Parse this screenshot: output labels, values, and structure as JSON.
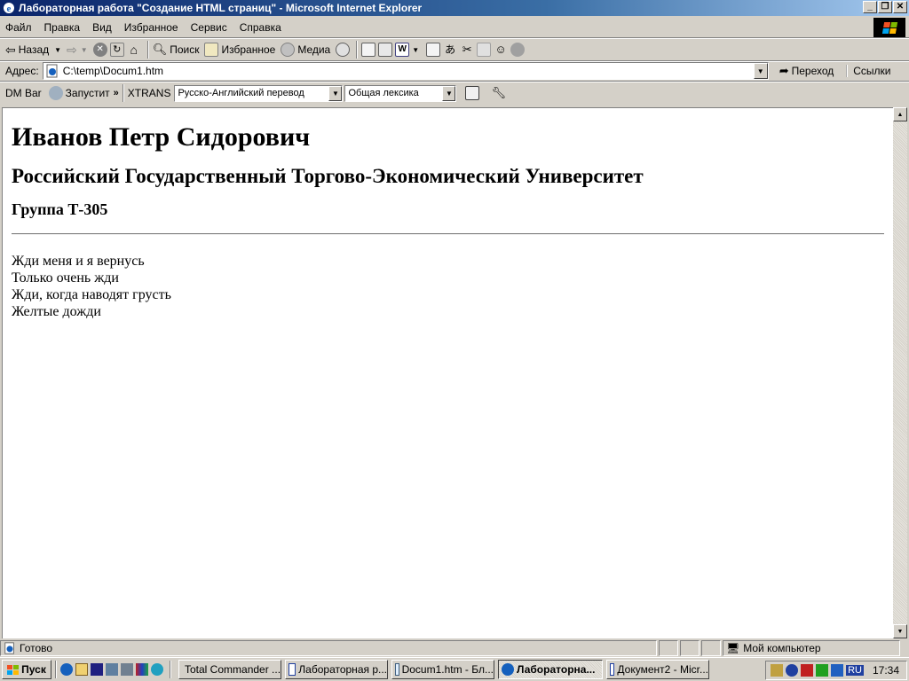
{
  "window": {
    "title": "Лабораторная работа \"Создание HTML страниц\" - Microsoft Internet Explorer"
  },
  "menu": [
    {
      "label": "Файл"
    },
    {
      "label": "Правка"
    },
    {
      "label": "Вид"
    },
    {
      "label": "Избранное"
    },
    {
      "label": "Сервис"
    },
    {
      "label": "Справка"
    }
  ],
  "toolbar": {
    "back_label": "Назад",
    "search_label": "Поиск",
    "favorites_label": "Избранное",
    "media_label": "Медиа"
  },
  "address": {
    "label": "Адрес:",
    "value": "C:\\temp\\Docum1.htm",
    "go_label": "Переход",
    "links_label": "Ссылки"
  },
  "linkbar": {
    "dm_label": "DM Bar",
    "run_label": "Запустит",
    "xtrans_label": "XTRANS",
    "translate_select": "Русско-Английский перевод",
    "lexicon_select": "Общая лексика"
  },
  "page": {
    "h1": "Иванов Петр Сидорович",
    "h2": "Российский Государственный Торгово-Экономический Университет",
    "h3": "Группа Т-305",
    "lines": [
      "Жди меня и я вернусь",
      "Только очень жди",
      "Жди, когда наводят грусть",
      "Желтые дожди"
    ]
  },
  "status": {
    "text": "Готово",
    "zone": "Мой компьютер"
  },
  "taskbar": {
    "start_label": "Пуск",
    "tasks": [
      {
        "label": "Total Commander ..."
      },
      {
        "label": "Лабораторная р..."
      },
      {
        "label": "Docum1.htm - Бл..."
      },
      {
        "label": "Лабораторна..."
      },
      {
        "label": "Документ2 - Micr..."
      }
    ],
    "language": "RU",
    "clock": "17:34"
  },
  "colors": {
    "title_gradient_start": "#0a246a",
    "title_gradient_end": "#a6caf0",
    "chrome": "#d4d0c8"
  }
}
